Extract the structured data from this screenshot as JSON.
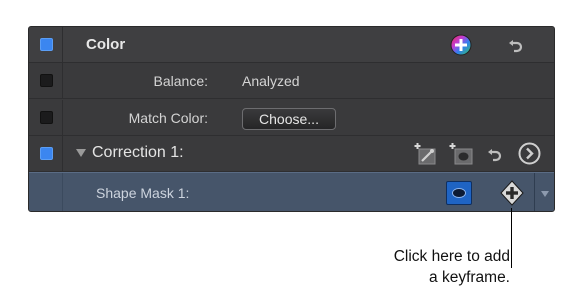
{
  "color_section": {
    "title": "Color",
    "enabled": true,
    "add_icon": "add-color-correction-icon",
    "reset_icon": "reset-icon"
  },
  "balance": {
    "label": "Balance:",
    "value": "Analyzed",
    "enabled": false
  },
  "match_color": {
    "label": "Match Color:",
    "button_label": "Choose...",
    "enabled": false
  },
  "correction": {
    "title": "Correction 1:",
    "enabled": true,
    "icons": [
      "add-color-mask-icon",
      "add-shape-mask-icon",
      "reset-icon",
      "go-to-board-icon"
    ]
  },
  "shape_mask": {
    "label": "Shape Mask 1:",
    "mask_icon": "shape-mask-view-icon",
    "keyframe_icon": "keyframe-add-icon",
    "menu_icon": "dropdown-arrow-icon"
  },
  "callout": {
    "line1": "Click here to add",
    "line2": "a keyframe."
  },
  "colors": {
    "panel_bg": "#3a3a3c",
    "selected_row": "#46556a",
    "checkbox_on": "#3b86f0",
    "mask_button": "#1f64c4"
  }
}
